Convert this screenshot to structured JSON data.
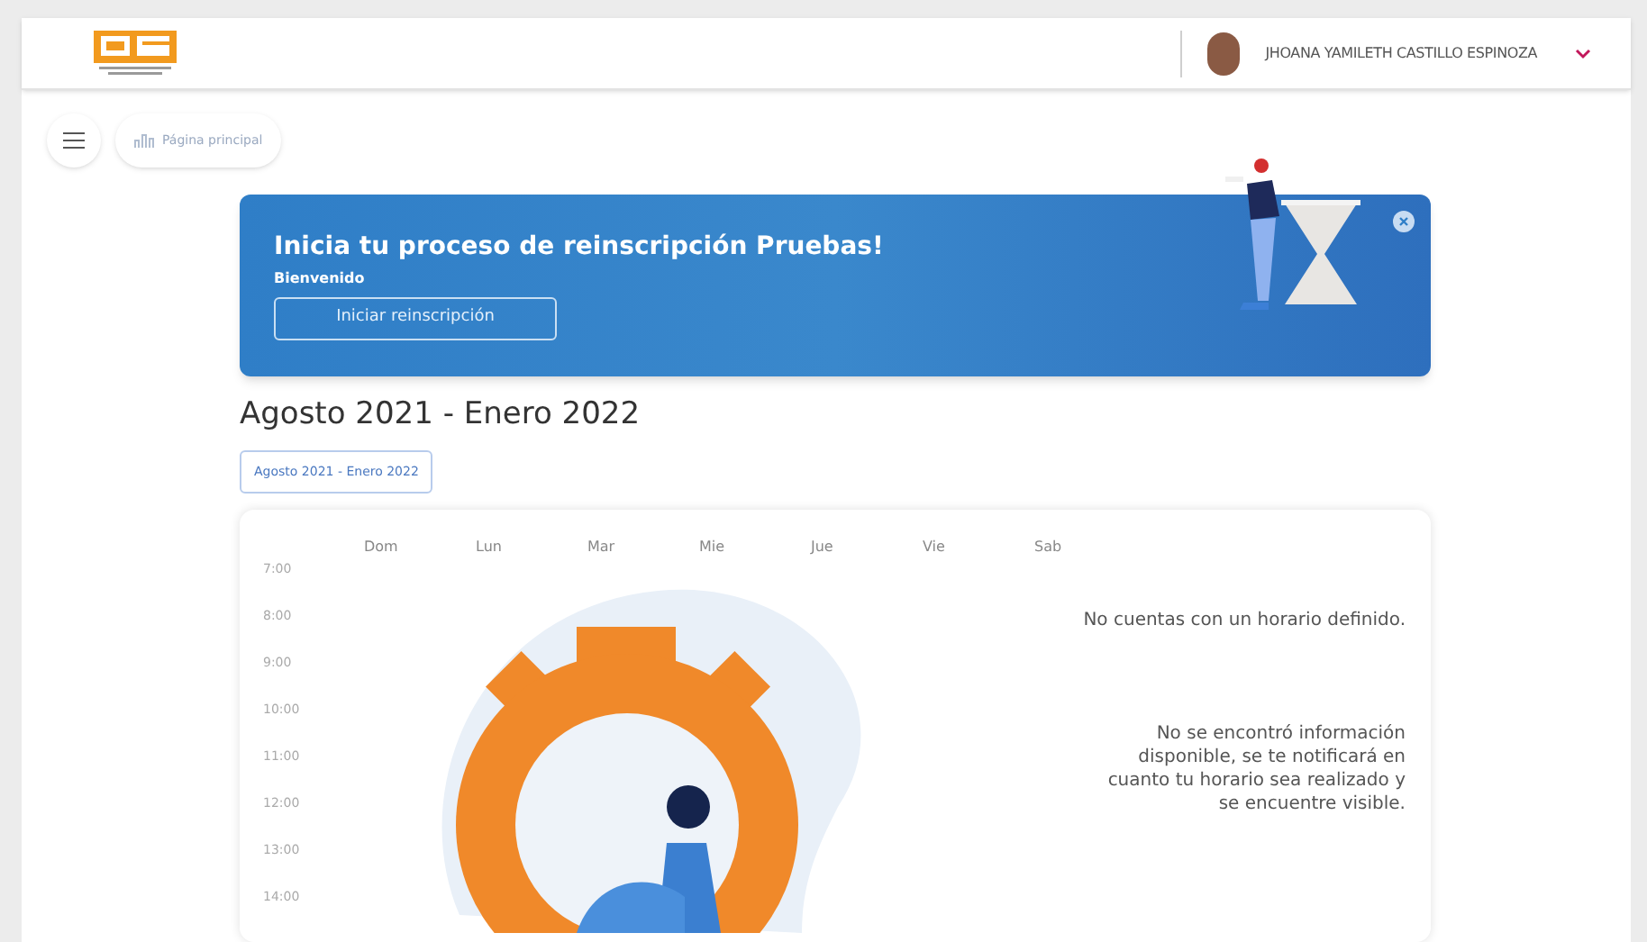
{
  "header": {
    "user_name": "JHOANA YAMILETH CASTILLO ESPINOZA"
  },
  "breadcrumb": {
    "label": "Página principal"
  },
  "banner": {
    "title": "Inicia tu proceso de reinscripción Pruebas!",
    "subtitle": "Bienvenido",
    "button": "Iniciar reinscripción"
  },
  "period": {
    "title": "Agosto 2021 - Enero 2022",
    "selector": "Agosto 2021 - Enero 2022"
  },
  "schedule": {
    "days": [
      "Dom",
      "Lun",
      "Mar",
      "Mie",
      "Jue",
      "Vie",
      "Sab"
    ],
    "hours": [
      "7:00",
      "8:00",
      "9:00",
      "10:00",
      "11:00",
      "12:00",
      "13:00",
      "14:00"
    ],
    "empty_title": "No cuentas con un horario definido.",
    "empty_message": "No se encontró información disponible, se te notificará en cuanto tu horario sea realizado y se encuentre visible."
  }
}
